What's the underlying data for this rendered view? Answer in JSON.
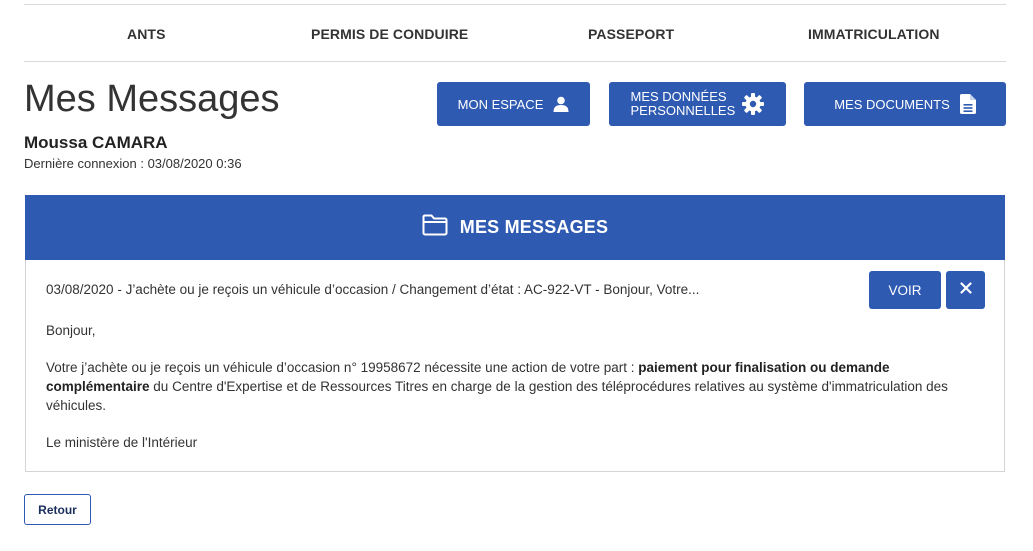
{
  "nav": {
    "ants": "ANTS",
    "permis": "PERMIS DE CONDUIRE",
    "passeport": "PASSEPORT",
    "immatriculation": "IMMATRICULATION"
  },
  "header": {
    "title": "Mes Messages",
    "user_name": "Moussa CAMARA",
    "last_login": "Dernière connexion : 03/08/2020 0:36"
  },
  "actions": {
    "mon_espace": "MON ESPACE",
    "mes_donnees_line1": "MES DONNÉES",
    "mes_donnees_line2": "PERSONNELLES",
    "mes_documents": "MES DOCUMENTS"
  },
  "panel": {
    "title": "MES MESSAGES",
    "icon": "folder-icon"
  },
  "message": {
    "subject": "03/08/2020 - J’achète ou je reçois un véhicule d’occasion / Changement d’état : AC-922-VT - Bonjour, Votre...",
    "voir_label": "VOIR",
    "greeting": "Bonjour,",
    "body_part1": "Votre j’achète ou je reçois un véhicule d’occasion n° 19958672 nécessite une action de votre part : ",
    "body_bold": "paiement pour finalisation ou demande complémentaire",
    "body_part2": " du Centre d'Expertise et de Ressources Titres en charge de la gestion des téléprocédures relatives au système d'immatriculation des véhicules.",
    "signature": "Le ministère de l'Intérieur"
  },
  "footer": {
    "retour": "Retour"
  },
  "colors": {
    "accent": "#2f5ab2",
    "text": "#333333",
    "border": "#d4d4d4"
  }
}
